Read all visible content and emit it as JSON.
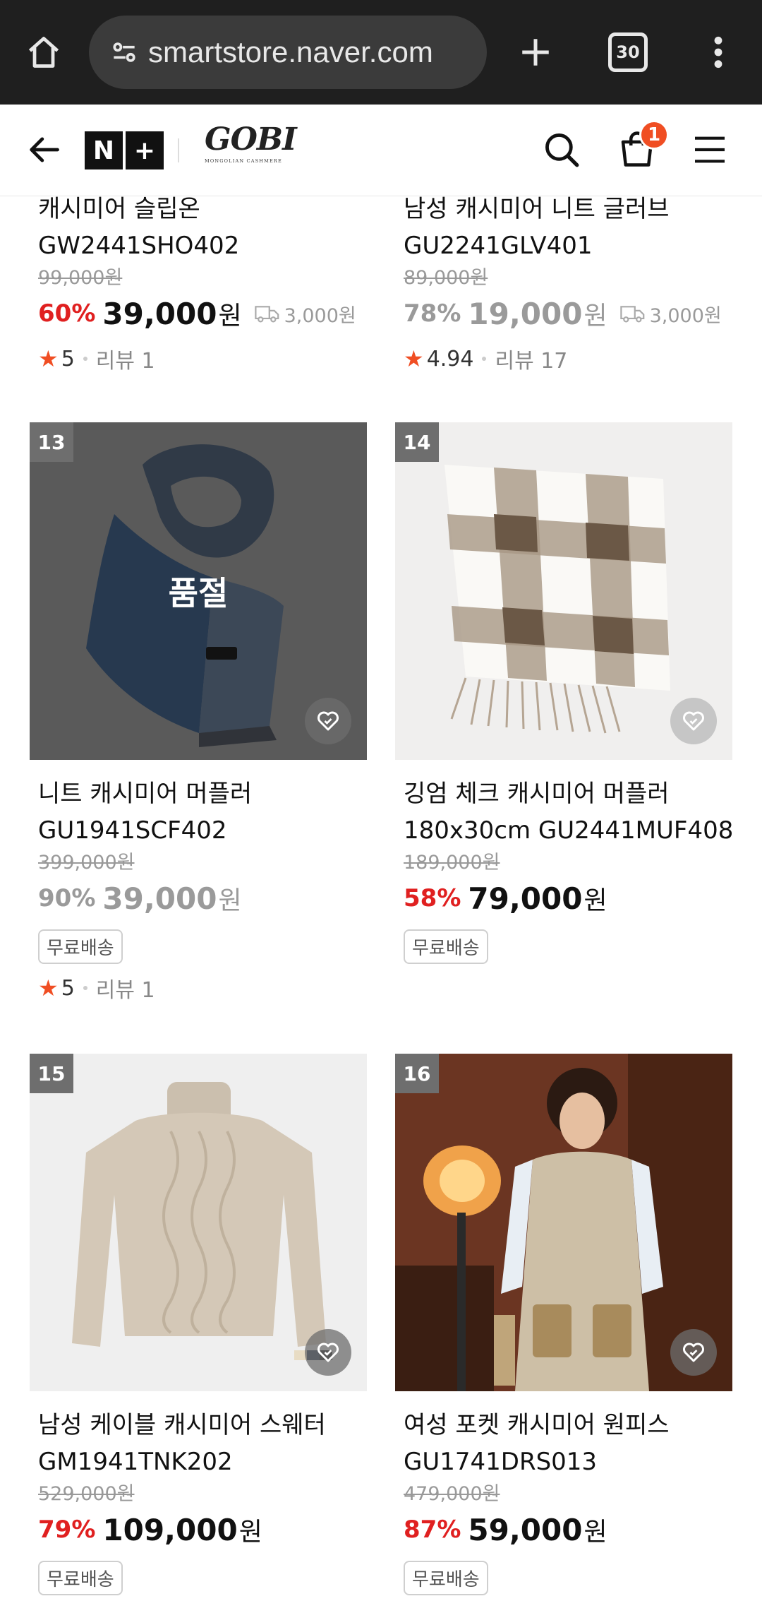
{
  "browser": {
    "url": "smartstore.naver.com",
    "tabs_count": "30"
  },
  "header": {
    "nplus_left": "N",
    "nplus_right": "+",
    "brand": "GOBI",
    "brand_sub": "MONGOLIAN CASHMERE",
    "cart_count": "1"
  },
  "products": [
    {
      "title_line1": "캐시미어 슬립온",
      "title_line2": "GW2441SHO402",
      "original_price": "99,000원",
      "discount": "60%",
      "price": "39,000",
      "currency": "원",
      "shipping": "3,000원",
      "rating": "5",
      "reviews": "리뷰 1"
    },
    {
      "title_line1": "남성 캐시미어 니트 글러브",
      "title_line2": "GU2241GLV401",
      "original_price": "89,000원",
      "discount": "78%",
      "price": "19,000",
      "currency": "원",
      "shipping": "3,000원",
      "rating": "4.94",
      "reviews": "리뷰 17"
    },
    {
      "rank": "13",
      "soldout": "품절",
      "title_line1": "니트 캐시미어 머플러",
      "title_line2": "GU1941SCF402",
      "original_price": "399,000원",
      "discount": "90%",
      "price": "39,000",
      "currency": "원",
      "tag": "무료배송",
      "rating": "5",
      "reviews": "리뷰 1"
    },
    {
      "rank": "14",
      "title_line1": "깅엄 체크 캐시미어 머플러",
      "title_line2": "180x30cm GU2441MUF408",
      "original_price": "189,000원",
      "discount": "58%",
      "price": "79,000",
      "currency": "원",
      "tag": "무료배송"
    },
    {
      "rank": "15",
      "title_line1": "남성 케이블 캐시미어 스웨터",
      "title_line2": "GM1941TNK202",
      "original_price": "529,000원",
      "discount": "79%",
      "price": "109,000",
      "currency": "원",
      "tag": "무료배송"
    },
    {
      "rank": "16",
      "title_line1": "여성 포켓 캐시미어 원피스",
      "title_line2": "GU1741DRS013",
      "original_price": "479,000원",
      "discount": "87%",
      "price": "59,000",
      "currency": "원",
      "tag": "무료배송"
    }
  ],
  "colors": {
    "discount_red": "#e02020",
    "badge_orange": "#f04e23",
    "chrome_bg": "#1f1f1f"
  }
}
